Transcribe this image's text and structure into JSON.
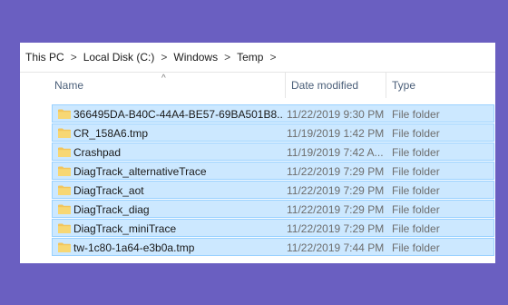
{
  "breadcrumb": [
    "This PC",
    "Local Disk (C:)",
    "Windows",
    "Temp"
  ],
  "columns": {
    "name": "Name",
    "date": "Date modified",
    "type": "Type"
  },
  "colors": {
    "selection_bg": "#cce8ff",
    "selection_border": "#99d1ff",
    "folder": "#f2c55c",
    "background": "#6a5fc1"
  },
  "rows": [
    {
      "name": "366495DA-B40C-44A4-BE57-69BA501B8...",
      "date": "11/22/2019 9:30 PM",
      "type": "File folder"
    },
    {
      "name": "CR_158A6.tmp",
      "date": "11/19/2019 1:42 PM",
      "type": "File folder"
    },
    {
      "name": "Crashpad",
      "date": "11/19/2019 7:42 A...",
      "type": "File folder"
    },
    {
      "name": "DiagTrack_alternativeTrace",
      "date": "11/22/2019 7:29 PM",
      "type": "File folder"
    },
    {
      "name": "DiagTrack_aot",
      "date": "11/22/2019 7:29 PM",
      "type": "File folder"
    },
    {
      "name": "DiagTrack_diag",
      "date": "11/22/2019 7:29 PM",
      "type": "File folder"
    },
    {
      "name": "DiagTrack_miniTrace",
      "date": "11/22/2019 7:29 PM",
      "type": "File folder"
    },
    {
      "name": "tw-1c80-1a64-e3b0a.tmp",
      "date": "11/22/2019 7:44 PM",
      "type": "File folder"
    }
  ]
}
